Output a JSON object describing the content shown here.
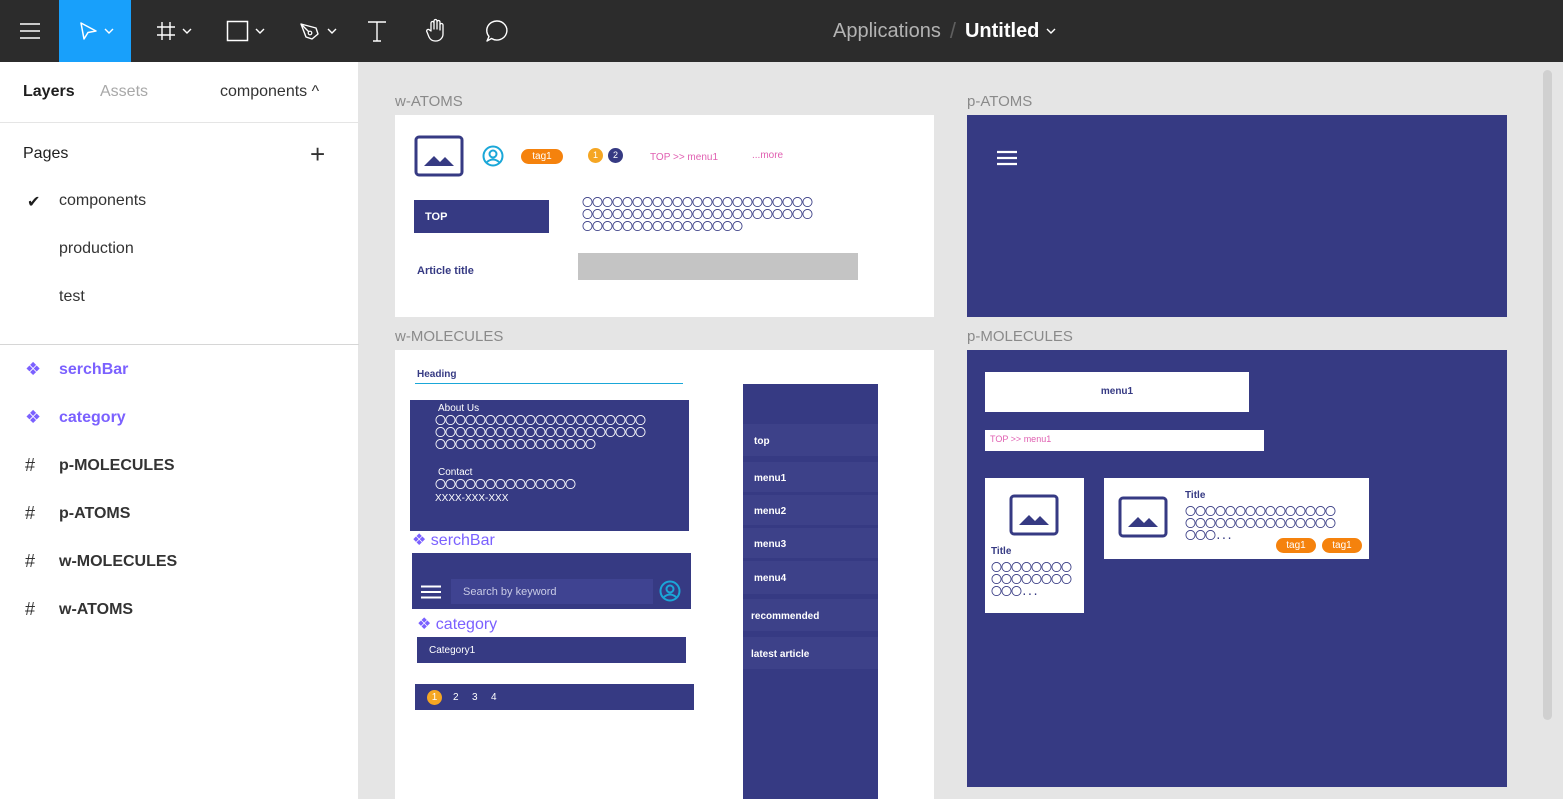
{
  "toolbar": {
    "breadcrumb_app": "Applications",
    "breadcrumb_sep": "/",
    "file_name": "Untitled",
    "file_chevron": "⌄",
    "icons": [
      "menu-icon",
      "move-tool-icon",
      "frame-tool-icon",
      "rectangle-tool-icon",
      "pen-tool-icon",
      "text-tool-icon",
      "hand-tool-icon",
      "comment-tool-icon"
    ],
    "active_color": "#18a0fb"
  },
  "left_panel": {
    "tabs": {
      "layers": "Layers",
      "assets": "Assets"
    },
    "page_select": "components ^",
    "pages_heading": "Pages",
    "add_page": "+",
    "pages": [
      {
        "label": "components",
        "selected": true
      },
      {
        "label": "production",
        "selected": false
      },
      {
        "label": "test",
        "selected": false
      }
    ],
    "layers": [
      {
        "label": "serchBar",
        "kind": "component"
      },
      {
        "label": "category",
        "kind": "component"
      },
      {
        "label": "p-MOLECULES",
        "kind": "frame"
      },
      {
        "label": "p-ATOMS",
        "kind": "frame"
      },
      {
        "label": "w-MOLECULES",
        "kind": "frame"
      },
      {
        "label": "w-ATOMS",
        "kind": "frame"
      }
    ],
    "component_color": "#7b61ff"
  },
  "canvas": {
    "frames": {
      "w_atoms": {
        "label": "w-ATOMS",
        "tag": "tag1",
        "badge1": "1",
        "badge2": "2",
        "breadcrumb": "TOP >> menu1",
        "more": "...more",
        "top_button": "TOP",
        "ooo_line1": "〇〇〇〇〇〇〇〇〇〇〇〇〇〇〇〇〇〇〇〇〇〇〇",
        "ooo_line2": "〇〇〇〇〇〇〇〇〇〇〇〇〇〇〇〇〇〇〇〇〇〇〇",
        "ooo_line3": "〇〇〇〇〇〇〇〇〇〇〇〇〇〇〇〇",
        "article_title": "Article title"
      },
      "p_atoms": {
        "label": "p-ATOMS"
      },
      "w_molecules": {
        "label": "w-MOLECULES",
        "heading": "Heading",
        "about_title": "About Us",
        "about_ooo1": "〇〇〇〇〇〇〇〇〇〇〇〇〇〇〇〇〇〇〇〇〇",
        "about_ooo2": "〇〇〇〇〇〇〇〇〇〇〇〇〇〇〇〇〇〇〇〇〇",
        "about_ooo3": "〇〇〇〇〇〇〇〇〇〇〇〇〇〇〇〇",
        "contact_title": "Contact",
        "contact_ooo": "〇〇〇〇〇〇〇〇〇〇〇〇〇〇",
        "contact_phone": "XXXX-XXX-XXX",
        "serchbar_label": "serchBar",
        "search_placeholder": "Search by keyword",
        "category_label": "category",
        "category_item": "Category1",
        "pagination": [
          "1",
          "2",
          "3",
          "4"
        ],
        "side_menu": [
          "top",
          "menu1",
          "menu2",
          "menu3",
          "menu4",
          "recommended",
          "latest article"
        ]
      },
      "p_molecules": {
        "label": "p-MOLECULES",
        "menu_button": "menu1",
        "breadcrumb": "TOP >> menu1",
        "card1_title": "Title",
        "card1_ooo1": "〇〇〇〇〇〇〇〇",
        "card1_ooo2": "〇〇〇〇〇〇〇〇",
        "card1_ooo3": "〇〇〇...",
        "card2_title": "Title",
        "card2_ooo1": "〇〇〇〇〇〇〇〇〇〇〇〇〇〇〇",
        "card2_ooo2": "〇〇〇〇〇〇〇〇〇〇〇〇〇〇〇",
        "card2_ooo3": "〇〇〇...",
        "card2_tag1": "tag1",
        "card2_tag2": "tag1"
      }
    },
    "colors": {
      "navy": "#363a83",
      "orange": "#f5820d",
      "pink": "#e05fb1",
      "cyan": "#1aa7d8"
    }
  }
}
